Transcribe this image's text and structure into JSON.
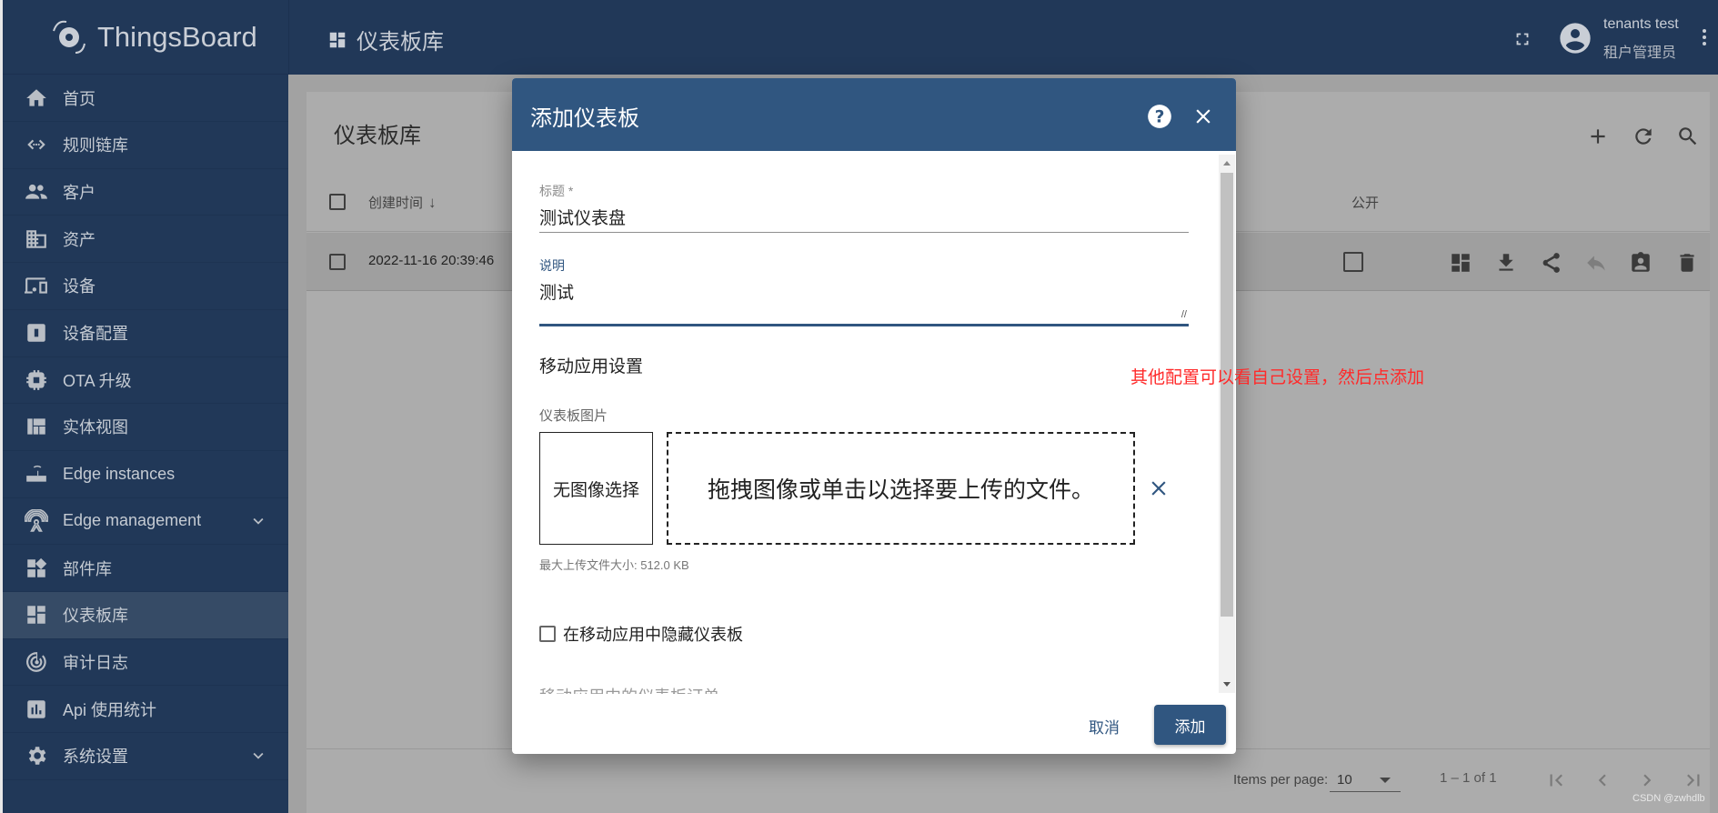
{
  "app": {
    "logo_text": "ThingsBoard",
    "page_title": "仪表板库"
  },
  "user": {
    "name": "tenants test",
    "role": "租户管理员"
  },
  "sidebar": {
    "items": [
      {
        "label": "首页",
        "icon": "home-icon"
      },
      {
        "label": "规则链库",
        "icon": "code-icon"
      },
      {
        "label": "客户",
        "icon": "people-icon"
      },
      {
        "label": "资产",
        "icon": "building-icon"
      },
      {
        "label": "设备",
        "icon": "devices-icon"
      },
      {
        "label": "设备配置",
        "icon": "device-profile-icon"
      },
      {
        "label": "OTA 升级",
        "icon": "chip-icon"
      },
      {
        "label": "实体视图",
        "icon": "view-quilt-icon"
      },
      {
        "label": "Edge instances",
        "icon": "router-icon"
      },
      {
        "label": "Edge management",
        "icon": "antenna-icon",
        "expandable": true
      },
      {
        "label": "部件库",
        "icon": "widgets-icon"
      },
      {
        "label": "仪表板库",
        "icon": "dashboard-icon",
        "active": true
      },
      {
        "label": "审计日志",
        "icon": "track-changes-icon"
      },
      {
        "label": "Api 使用统计",
        "icon": "chart-icon"
      },
      {
        "label": "系统设置",
        "icon": "gear-icon",
        "expandable": true
      }
    ]
  },
  "card": {
    "title": "仪表板库",
    "columns": {
      "created": "创建时间",
      "public": "公开"
    },
    "rows": [
      {
        "created": "2022-11-16 20:39:46",
        "public": false
      }
    ],
    "pagination": {
      "items_per_page_label": "Items per page:",
      "items_per_page": "10",
      "range": "1 – 1 of 1"
    }
  },
  "dialog": {
    "title": "添加仪表板",
    "title_label": "标题 *",
    "title_value": "测试仪表盘",
    "desc_label": "说明",
    "desc_value": "测试",
    "mobile_section": "移动应用设置",
    "image_label": "仪表板图片",
    "no_image": "无图像选择",
    "dropzone": "拖拽图像或单击以选择要上传的文件。",
    "max_size": "最大上传文件大小: 512.0 KB",
    "hide_mobile": "在移动应用中隐藏仪表板",
    "hide_mobile_checked": false,
    "mobile_order_label": "移动应用中的仪表板订单",
    "cancel": "取消",
    "add": "添加"
  },
  "annotation": "其他配置可以看自己设置，然后点添加",
  "watermark": "CSDN @zwhdlb",
  "colors": {
    "primary": "#305680",
    "sidebar": "#213858",
    "annotation": "#ff2a2a"
  }
}
